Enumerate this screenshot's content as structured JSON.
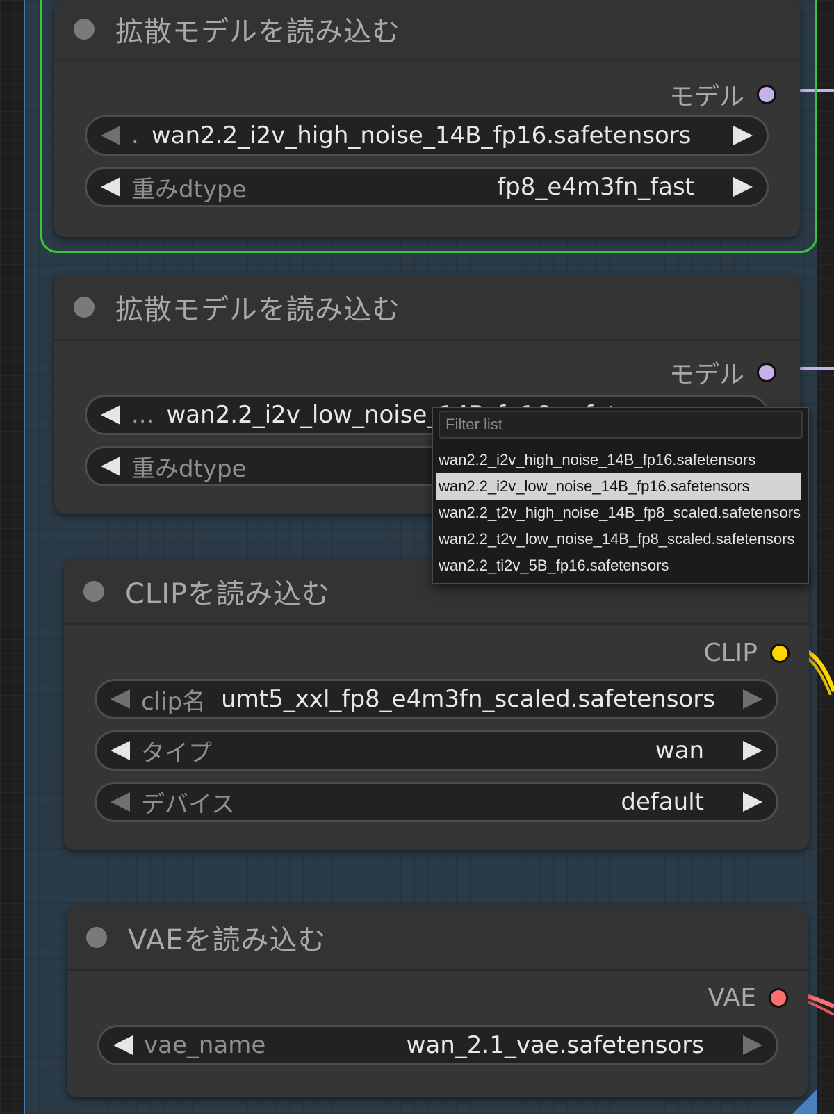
{
  "colors": {
    "selection_outline": "#39c639",
    "model_port": "#c6b1e8",
    "clip_port": "#ffd500",
    "vae_port": "#ff6e6e",
    "group_background": "#2a3a47"
  },
  "nodes": [
    {
      "title": "拡散モデルを読み込む",
      "output_label": "モデル",
      "widgets": [
        {
          "label": "",
          "prefix": ".",
          "value": "wan2.2_i2v_high_noise_14B_fp16.safetensors"
        },
        {
          "label": "重みdtype",
          "value": "fp8_e4m3fn_fast"
        }
      ]
    },
    {
      "title": "拡散モデルを読み込む",
      "output_label": "モデル",
      "widgets": [
        {
          "label": "",
          "prefix": "...",
          "value": "wan2.2_i2v_low_noise_14B_fp16.safetensors"
        },
        {
          "label": "重みdtype",
          "value": ""
        }
      ]
    },
    {
      "title": "CLIPを読み込む",
      "output_label": "CLIP",
      "widgets": [
        {
          "label": "clip名",
          "value": "umt5_xxl_fp8_e4m3fn_scaled.safetensors"
        },
        {
          "label": "タイプ",
          "value": "wan"
        },
        {
          "label": "デバイス",
          "value": "default"
        }
      ]
    },
    {
      "title": "VAEを読み込む",
      "output_label": "VAE",
      "widgets": [
        {
          "label": "vae_name",
          "value": "wan_2.1_vae.safetensors"
        }
      ]
    }
  ],
  "dropdown": {
    "filter_placeholder": "Filter list",
    "items": [
      "wan2.2_i2v_high_noise_14B_fp16.safetensors",
      "wan2.2_i2v_low_noise_14B_fp16.safetensors",
      "wan2.2_t2v_high_noise_14B_fp8_scaled.safetensors",
      "wan2.2_t2v_low_noise_14B_fp8_scaled.safetensors",
      "wan2.2_ti2v_5B_fp16.safetensors"
    ],
    "selected": "wan2.2_i2v_low_noise_14B_fp16.safetensors"
  }
}
